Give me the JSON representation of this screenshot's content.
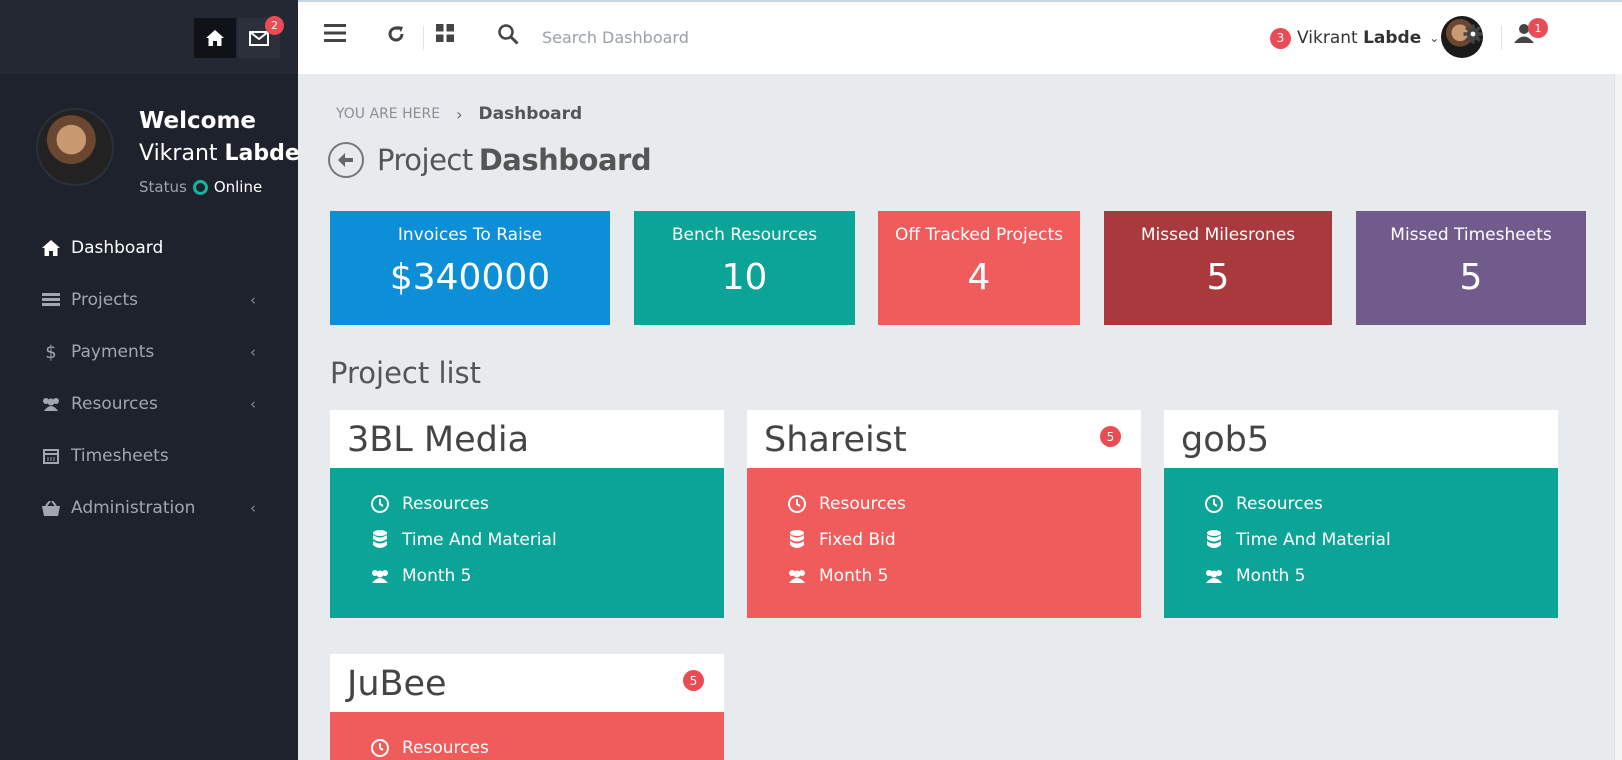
{
  "colors": {
    "sidebar_bg": "#1d222c",
    "accent_teal": "#0ca497",
    "accent_red": "#f05b5b",
    "accent_blue": "#0c8fd6",
    "accent_darkred": "#a8393c",
    "accent_purple": "#705b8c",
    "badge": "#ea4c55"
  },
  "sidebar": {
    "top": {
      "home_icon": "home-icon",
      "mail_icon": "envelope-icon",
      "mail_badge": "2"
    },
    "profile": {
      "welcome": "Welcome",
      "first_name": "Vikrant",
      "last_name": "Labde",
      "status_label": "Status",
      "status_value": "Online"
    },
    "items": [
      {
        "label": "Dashboard",
        "icon": "home-icon",
        "active": true,
        "has_submenu": false
      },
      {
        "label": "Projects",
        "icon": "list-icon",
        "active": false,
        "has_submenu": true
      },
      {
        "label": "Payments",
        "icon": "dollar-icon",
        "active": false,
        "has_submenu": true
      },
      {
        "label": "Resources",
        "icon": "users-icon",
        "active": false,
        "has_submenu": true
      },
      {
        "label": "Timesheets",
        "icon": "calendar-icon",
        "active": false,
        "has_submenu": false
      },
      {
        "label": "Administration",
        "icon": "basket-icon",
        "active": false,
        "has_submenu": true
      }
    ]
  },
  "topbar": {
    "search_placeholder": "Search Dashboard",
    "notif_badge": "3",
    "user_first": "Vikrant",
    "user_last": "Labde",
    "user_badge": "1"
  },
  "breadcrumb": {
    "here": "YOU ARE HERE",
    "current": "Dashboard"
  },
  "page_title": {
    "light": "Project",
    "bold": "Dashboard"
  },
  "stats": [
    {
      "label": "Invoices To Raise",
      "value": "$340000"
    },
    {
      "label": "Bench Resources",
      "value": "10"
    },
    {
      "label": "Off Tracked Projects",
      "value": "4"
    },
    {
      "label": "Missed Milesrones",
      "value": "5"
    },
    {
      "label": "Missed Timesheets",
      "value": "5"
    }
  ],
  "project_list_title": "Project list",
  "projects": [
    {
      "name": "3BL Media",
      "badge": "",
      "lines": [
        "Resources",
        "Time And Material",
        "Month 5"
      ]
    },
    {
      "name": "Shareist",
      "badge": "5",
      "lines": [
        "Resources",
        "Fixed Bid",
        "Month 5"
      ]
    },
    {
      "name": "gob5",
      "badge": "",
      "lines": [
        "Resources",
        "Time And Material",
        "Month 5"
      ]
    },
    {
      "name": "JuBee",
      "badge": "5",
      "lines": [
        "Resources"
      ]
    }
  ]
}
